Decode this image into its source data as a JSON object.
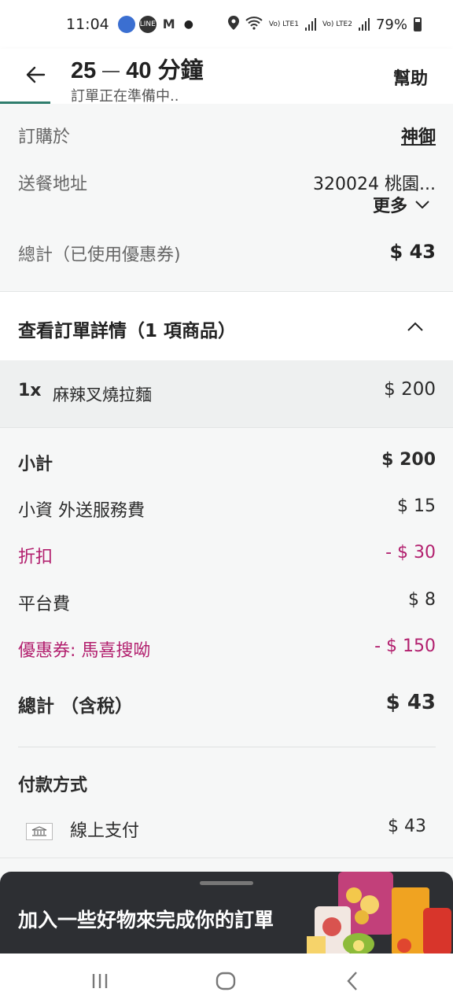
{
  "status_bar": {
    "time": "11:04",
    "net1": "Vo) LTE1",
    "net2": "Vo) LTE2",
    "battery": "79%"
  },
  "header": {
    "eta_min": "25",
    "eta_max": "40",
    "eta_unit": "分鐘",
    "status": "訂單正在準備中..",
    "help": "幫助"
  },
  "order_info": {
    "ordered_at_label": "訂購於",
    "store_name": "神御",
    "address_label": "送餐地址",
    "address": "320024 桃園...",
    "more": "更多",
    "total_coupon_label": "總計（已使用優惠券)",
    "total_coupon_value": "$ 43"
  },
  "details": {
    "title": "查看訂單詳情（1 項商品）"
  },
  "items": [
    {
      "qty": "1x",
      "name": "麻辣叉燒拉麵",
      "price": "$ 200"
    }
  ],
  "summary": {
    "subtotal_label": "小計",
    "subtotal_value": "$ 200",
    "fee_label": "小資 外送服務費",
    "fee_value": "$ 15",
    "discount_label": "折扣",
    "discount_value": "- $ 30",
    "platform_label": "平台費",
    "platform_value": "$ 8",
    "coupon_label": "優惠券: 馬喜搜呦",
    "coupon_value": "- $ 150",
    "total_label": "總計 （含稅）",
    "total_value": "$ 43"
  },
  "payment": {
    "title": "付款方式",
    "method": "線上支付",
    "amount": "$ 43"
  },
  "promo": {
    "text": "加入一些好物來完成你的訂單"
  },
  "colors": {
    "discount": "#b21f6e",
    "accent": "#2f7d6d",
    "promo_bg": "#2d2f33"
  }
}
